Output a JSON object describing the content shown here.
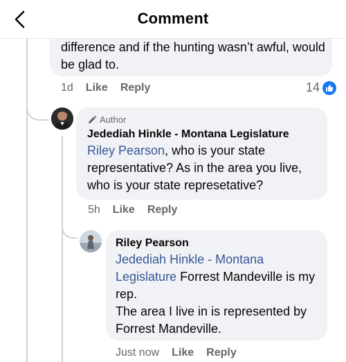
{
  "header": {
    "title": "Comment",
    "back_icon": "chevron-left-icon"
  },
  "comment_prev": {
    "text": "difference and if the hunting wasn’t awful, would be glad to.",
    "time": "1d",
    "like_label": "Like",
    "reply_label": "Reply",
    "reaction_count": "14",
    "reaction_icon": "thumbs-up-icon"
  },
  "comment_author": {
    "badge": "Author",
    "badge_icon": "pencil-icon",
    "name": "Jedediah Hinkle - Montana Legislature",
    "mention": "Riley Pearson",
    "text": ", who is your state representative?  As in the area you live, who is your state represetative?",
    "time": "5h",
    "like_label": "Like",
    "reply_label": "Reply"
  },
  "comment_reply": {
    "name": "Riley Pearson",
    "mention": "Jedediah Hinkle - Montana Legislature",
    "text": " Forrest Mandeville is my rep.",
    "text_line2": "The area I live in is represented by Forrest Mandeville.",
    "time": "Just now",
    "like_label": "Like",
    "reply_label": "Reply"
  },
  "colors": {
    "bubble": "#f0f2f5",
    "mention": "#385898",
    "muted": "#65676b",
    "like_blue": "#1877f2"
  }
}
